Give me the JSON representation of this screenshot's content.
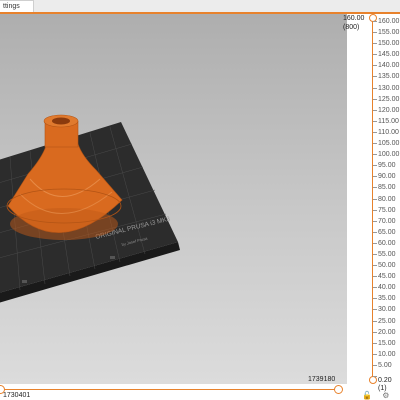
{
  "tab": {
    "label": "ttings"
  },
  "vertical_slider": {
    "top_value": "160.00",
    "top_layer": "(800)",
    "bottom_value": "0.20",
    "bottom_layer": "(1)",
    "ticks": [
      "160.00",
      "155.00",
      "150.00",
      "145.00",
      "140.00",
      "135.00",
      "130.00",
      "125.00",
      "120.00",
      "115.00",
      "110.00",
      "105.00",
      "100.00",
      "95.00",
      "90.00",
      "85.00",
      "80.00",
      "75.00",
      "70.00",
      "65.00",
      "60.00",
      "55.00",
      "50.00",
      "45.00",
      "40.00",
      "35.00",
      "30.00",
      "25.00",
      "20.00",
      "15.00",
      "10.00",
      "5.00",
      "0.20"
    ]
  },
  "horizontal_slider": {
    "left_value": "1730401",
    "right_value": "1739180"
  },
  "bed": {
    "brand": "ORIGINAL PRUSA i3 MK3",
    "by": "by Josef Prusa"
  },
  "icons": {
    "lock": "lock-icon",
    "settings": "gear-icon"
  },
  "colors": {
    "accent": "#e8822c",
    "model": "#d96a1f"
  }
}
